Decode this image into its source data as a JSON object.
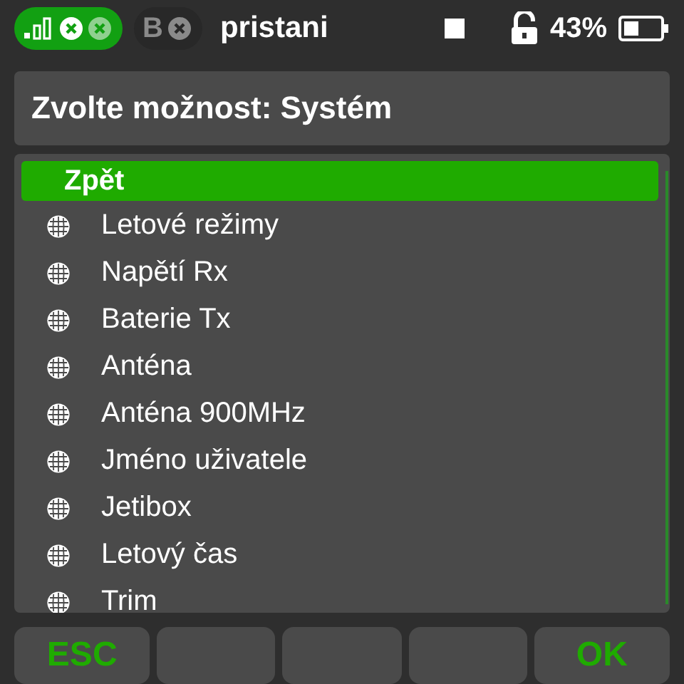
{
  "status_bar": {
    "receiver": "B",
    "model": "pristani",
    "battery": "43%"
  },
  "dialog": {
    "title": "Zvolte možnost: Systém"
  },
  "options": [
    {
      "kind": "back",
      "label": "Zpět",
      "selected": true
    },
    {
      "kind": "item",
      "label": "Letové režimy",
      "selected": false
    },
    {
      "kind": "item",
      "label": "Napětí Rx",
      "selected": false
    },
    {
      "kind": "item",
      "label": "Baterie Tx",
      "selected": false
    },
    {
      "kind": "item",
      "label": "Anténa",
      "selected": false
    },
    {
      "kind": "item",
      "label": "Anténa 900MHz",
      "selected": false
    },
    {
      "kind": "item",
      "label": "Jméno uživatele",
      "selected": false
    },
    {
      "kind": "item",
      "label": "Jetibox",
      "selected": false
    },
    {
      "kind": "item",
      "label": "Letový čas",
      "selected": false
    },
    {
      "kind": "item",
      "label": "Trim",
      "selected": false
    }
  ],
  "softkeys": [
    {
      "kind": "key",
      "label": "ESC"
    },
    {
      "kind": "blank"
    },
    {
      "kind": "blank"
    },
    {
      "kind": "blank"
    },
    {
      "kind": "key",
      "label": "OK"
    }
  ]
}
